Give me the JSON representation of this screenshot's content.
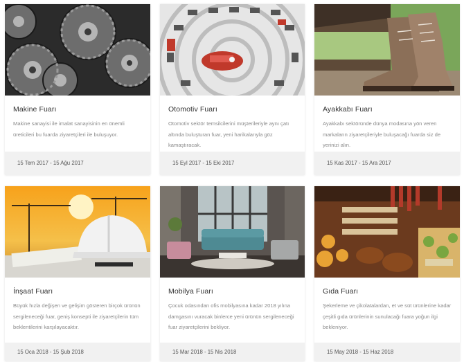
{
  "cards": [
    {
      "title": "Makine Fuarı",
      "description": "Makine sanayisi ile imalat sanayisinin en önemli üreticileri bu fuarda ziyaretçileri ile buluşuyor.",
      "date": "15 Tem 2017 - 15 Ağu 2017",
      "image": "gears-machinery"
    },
    {
      "title": "Otomotiv Fuarı",
      "description": "Otomotiv sektör temsilcilerini müşterileriyle aynı çatı altında buluşturan fuar, yeni harikalarıyla göz kamaştıracak.",
      "date": "15 Eyl 2017 - 15 Eki 2017",
      "image": "car-tower"
    },
    {
      "title": "Ayakkabı Fuarı",
      "description": "Ayakkabı sektöründe dünya modasına yön veren markaların ziyaretçileriyle buluşacağı fuarda siz de yerinizi alın.",
      "date": "15 Kas 2017 - 15 Ara 2017",
      "image": "hiking-boots"
    },
    {
      "title": "İnşaat Fuarı",
      "description": "Büyük hızla değişen ve gelişim gösteren birçok ürünün sergileneceği fuar, geniş konsepti ile ziyaretçilerin tüm beklentilerini karşılayacaktır.",
      "date": "15 Oca 2018 - 15 Şub 2018",
      "image": "construction-helmet"
    },
    {
      "title": "Mobilya Fuarı",
      "description": "Çocuk odasından ofis mobilyasına kadar 2018 yılına damgasını vuracak binlerce yeni ürünün sergileneceği fuar ziyaretçilerini bekliyor.",
      "date": "15 Mar 2018 - 15 Nis 2018",
      "image": "living-room"
    },
    {
      "title": "Gıda Fuarı",
      "description": "Şekerleme ve çikolatalardan, et ve süt ürünlerine kadar çeşitli gıda ürünlerinin sunulacağı fuara yoğun ilgi bekleniyor.",
      "date": "15 May 2018 - 15 Haz 2018",
      "image": "food-market"
    }
  ]
}
